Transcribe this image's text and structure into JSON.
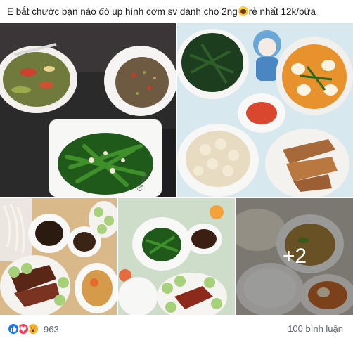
{
  "post": {
    "caption": "E bắt chước bạn nào đó up hình cơm sv dành cho 2ng",
    "caption_emoji": "grinning-sweat-emoji",
    "caption_suffix": "rẻ nhất 12k/bữa"
  },
  "photos": {
    "plate_brand": "Olivola",
    "more_count": "+2"
  },
  "reactions": {
    "types": [
      "like-icon",
      "love-icon",
      "wow-icon"
    ],
    "count": "963"
  },
  "comments": {
    "label": "100 bình luận"
  },
  "colors": {
    "like": "#1877f2",
    "love": "#f33e58",
    "wow": "#f7b125",
    "meta_text": "#606770"
  }
}
